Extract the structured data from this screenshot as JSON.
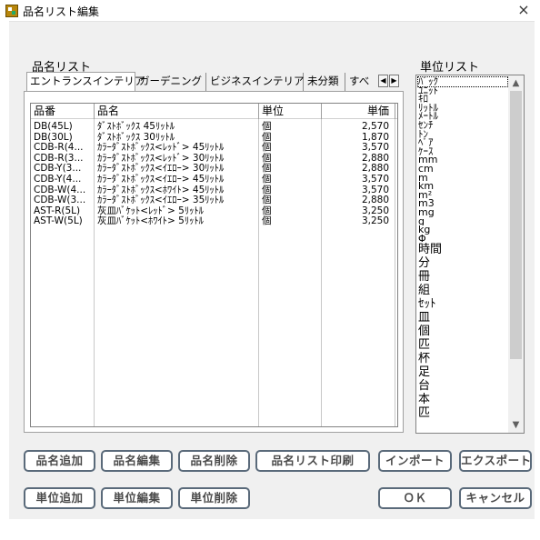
{
  "window": {
    "title": "品名リスト編集",
    "close_glyph": "×"
  },
  "product_list": {
    "label": "品名リスト",
    "tabs": [
      "エントランスインテリア",
      "ガーデニング",
      "ビジネスインテリア",
      "未分類",
      "すべ"
    ],
    "tab_scroll_left": "◀",
    "tab_scroll_right": "▶",
    "columns": [
      "品番",
      "品名",
      "単位",
      "単価"
    ],
    "rows": [
      [
        "DB(45L)",
        "ﾀﾞｽﾄﾎﾞｯｸｽ 45ﾘｯﾄﾙ",
        "個",
        "2,570"
      ],
      [
        "DB(30L)",
        "ﾀﾞｽﾄﾎﾞｯｸｽ 30ﾘｯﾄﾙ",
        "個",
        "1,870"
      ],
      [
        "CDB-R(4...",
        "ｶﾗｰﾀﾞｽﾄﾎﾞｯｸｽ<ﾚｯﾄﾞ> 45ﾘｯﾄﾙ",
        "個",
        "3,570"
      ],
      [
        "CDB-R(3...",
        "ｶﾗｰﾀﾞｽﾄﾎﾞｯｸｽ<ﾚｯﾄﾞ> 30ﾘｯﾄﾙ",
        "個",
        "2,880"
      ],
      [
        "CDB-Y(3...",
        "ｶﾗｰﾀﾞｽﾄﾎﾞｯｸｽ<ｲｴﾛｰ> 30ﾘｯﾄﾙ",
        "個",
        "2,880"
      ],
      [
        "CDB-Y(4...",
        "ｶﾗｰﾀﾞｽﾄﾎﾞｯｸｽ<ｲｴﾛｰ> 45ﾘｯﾄﾙ",
        "個",
        "3,570"
      ],
      [
        "CDB-W(4...",
        "ｶﾗｰﾀﾞｽﾄﾎﾞｯｸｽ<ﾎﾜｲﾄ> 45ﾘｯﾄﾙ",
        "個",
        "3,570"
      ],
      [
        "CDB-W(3...",
        "ｶﾗｰﾀﾞｽﾄﾎﾞｯｸｽ<ｲｴﾛｰ> 35ﾘｯﾄﾙ",
        "個",
        "2,880"
      ],
      [
        "AST-R(5L)",
        "灰皿ﾊﾞｹｯﾄ<ﾚｯﾄﾞ> 5ﾘｯﾄﾙ",
        "個",
        "3,250"
      ],
      [
        "AST-W(5L)",
        "灰皿ﾊﾞｹｯﾄ<ﾎﾜｲﾄ> 5ﾘｯﾄﾙ",
        "個",
        "3,250"
      ]
    ]
  },
  "unit_list": {
    "label": "単位リスト",
    "items_small": [
      "ﾊﾞｯｸ",
      "ﾕﾆｯﾄ",
      "ｷﾛ",
      "ﾘｯﾄﾙ",
      "ﾒｰﾄﾙ",
      "ｾﾝﾁ",
      "ﾄﾝ",
      "ﾍﾟｱ",
      "ｹｰｽ",
      "mm",
      "cm",
      "m",
      "km",
      "m²",
      "m3",
      "mg",
      "g",
      "kg",
      "Φ"
    ],
    "items_big": [
      "時間",
      "分",
      "冊",
      "組",
      "ｾｯﾄ",
      "皿",
      "個",
      "匹",
      "杯",
      "足",
      "台",
      "本",
      "匹"
    ],
    "scroll_up": "▲",
    "scroll_down": "▼"
  },
  "buttons": {
    "add_product": "品名追加",
    "edit_product": "品名編集",
    "delete_product": "品名削除",
    "print_list": "品名リスト印刷",
    "import": "インポート",
    "export": "エクスポート",
    "add_unit": "単位追加",
    "edit_unit": "単位編集",
    "delete_unit": "単位削除",
    "ok": "ＯＫ",
    "cancel": "キャンセル"
  }
}
